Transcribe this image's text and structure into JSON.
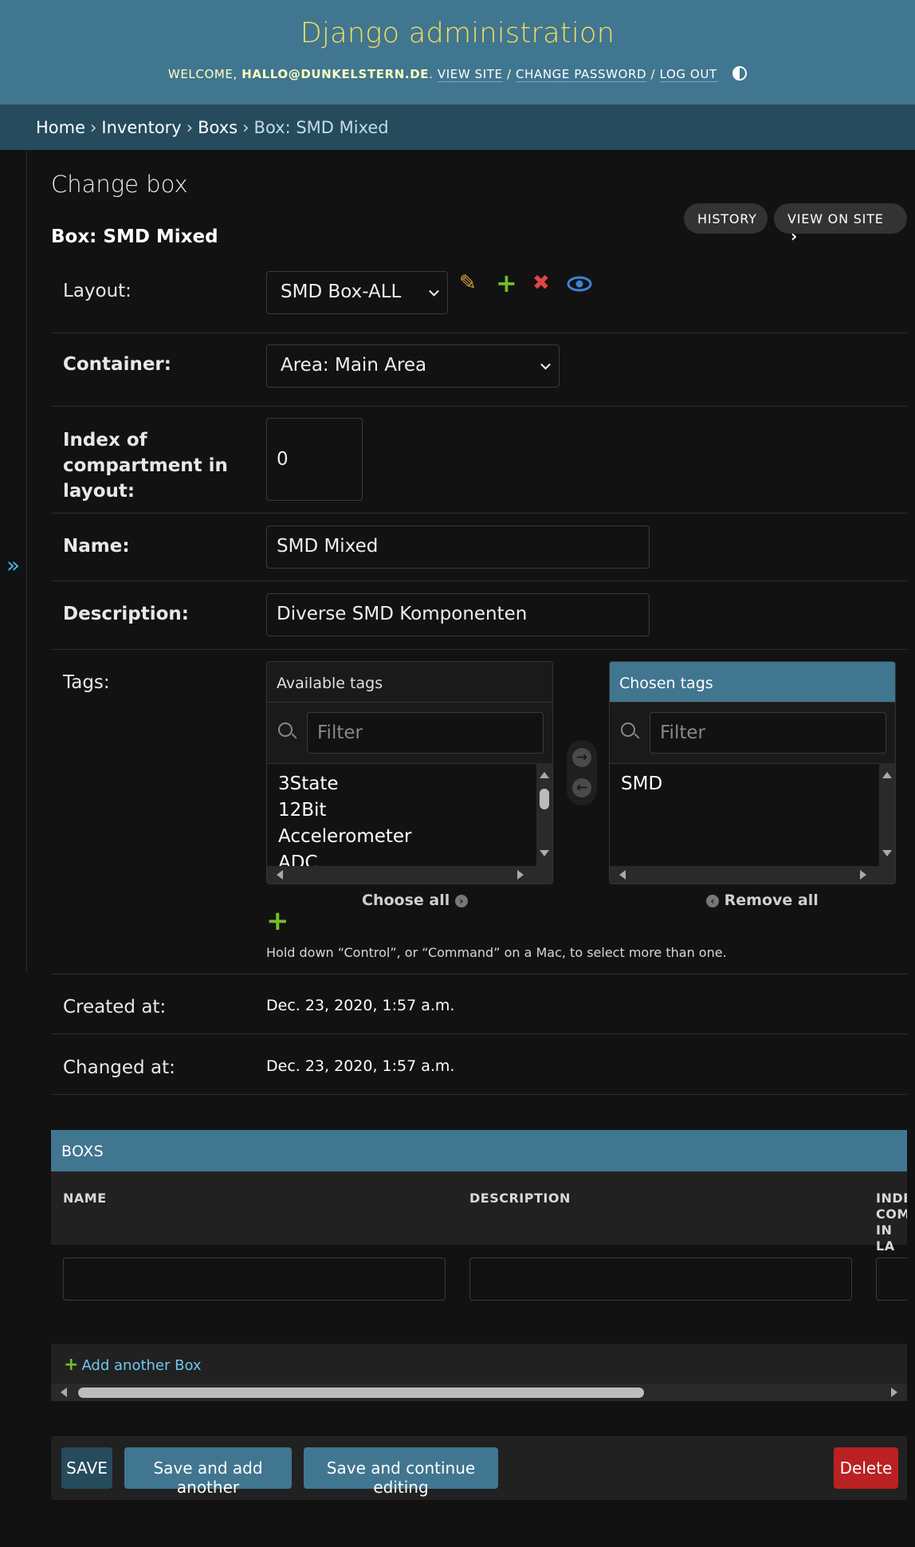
{
  "header": {
    "site_title": "Django administration",
    "welcome": "Welcome,",
    "user": "hallo@dunkelstern.de",
    "view_site": "View site",
    "change_password": "Change password",
    "log_out": "Log out"
  },
  "breadcrumbs": [
    "Home",
    "Inventory",
    "Boxs",
    "Box: SMD Mixed"
  ],
  "page": {
    "title": "Change box",
    "subtitle": "Box: SMD Mixed",
    "history": "History",
    "view_on_site": "View on site"
  },
  "form": {
    "layout": {
      "label": "Layout:",
      "value": "SMD Box-ALL"
    },
    "container": {
      "label": "Container:",
      "value": "Area: Main Area"
    },
    "index": {
      "label_lines": [
        "Index of",
        "compartment in",
        "layout:"
      ],
      "value": "0"
    },
    "name": {
      "label": "Name:",
      "value": "SMD Mixed"
    },
    "description": {
      "label": "Description:",
      "value": "Diverse SMD Komponenten"
    },
    "tags": {
      "label": "Tags:",
      "available_title": "Available tags",
      "chosen_title": "Chosen tags",
      "filter_placeholder": "Filter",
      "available": [
        "3State",
        "12Bit",
        "Accelerometer",
        "ADC"
      ],
      "chosen": [
        "SMD"
      ],
      "choose_all": "Choose all",
      "remove_all": "Remove all",
      "help": "Hold down “Control”, or “Command” on a Mac, to select more than one."
    },
    "created": {
      "label": "Created at:",
      "value": "Dec. 23, 2020, 1:57 a.m."
    },
    "changed": {
      "label": "Changed at:",
      "value": "Dec. 23, 2020, 1:57 a.m."
    }
  },
  "inline": {
    "title": "BOXS",
    "columns": {
      "name": "NAME",
      "description": "DESCRIPTION",
      "index_lines": [
        "INDE",
        "COM",
        "IN LA"
      ]
    },
    "add_another": "Add another Box"
  },
  "submit": {
    "save": "SAVE",
    "save_add": "Save and add another",
    "save_continue": "Save and continue editing",
    "delete": "Delete"
  },
  "colors": {
    "header": "#417690",
    "breadcrumb": "#264b5d",
    "title": "#f5dd5d",
    "delete": "#ba2121",
    "add_green": "#70bf2b"
  }
}
